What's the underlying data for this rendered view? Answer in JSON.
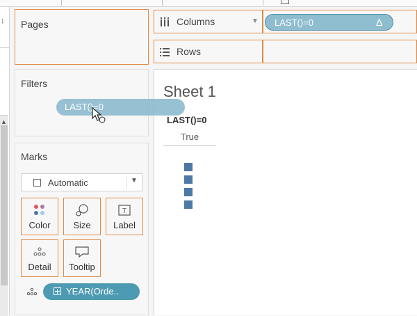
{
  "cards": {
    "pages_title": "Pages",
    "filters_title": "Filters",
    "marks_title": "Marks"
  },
  "marks": {
    "type_label": "Automatic",
    "buttons": [
      {
        "label": "Color",
        "icon": "color-dots-icon"
      },
      {
        "label": "Size",
        "icon": "size-icon"
      },
      {
        "label": "Label",
        "icon": "label-icon"
      },
      {
        "label": "Detail",
        "icon": "detail-icon"
      },
      {
        "label": "Tooltip",
        "icon": "tooltip-icon"
      }
    ],
    "detail_pill": "YEAR(Orde.."
  },
  "shelves": {
    "columns_label": "Columns",
    "rows_label": "Rows",
    "columns_pill": "LAST()=0",
    "columns_pill_flag": "Δ"
  },
  "drag": {
    "pill": "LAST()=0"
  },
  "view": {
    "sheet_title": "Sheet 1",
    "field_header": "LAST()=0",
    "column_value": "True",
    "mark_count": 4,
    "mark_color": "#4e79a7"
  },
  "colors": {
    "accent_border": "#e08a45",
    "pill_blue": "#4d9bb3",
    "pill_light": "#8fbdd0"
  }
}
